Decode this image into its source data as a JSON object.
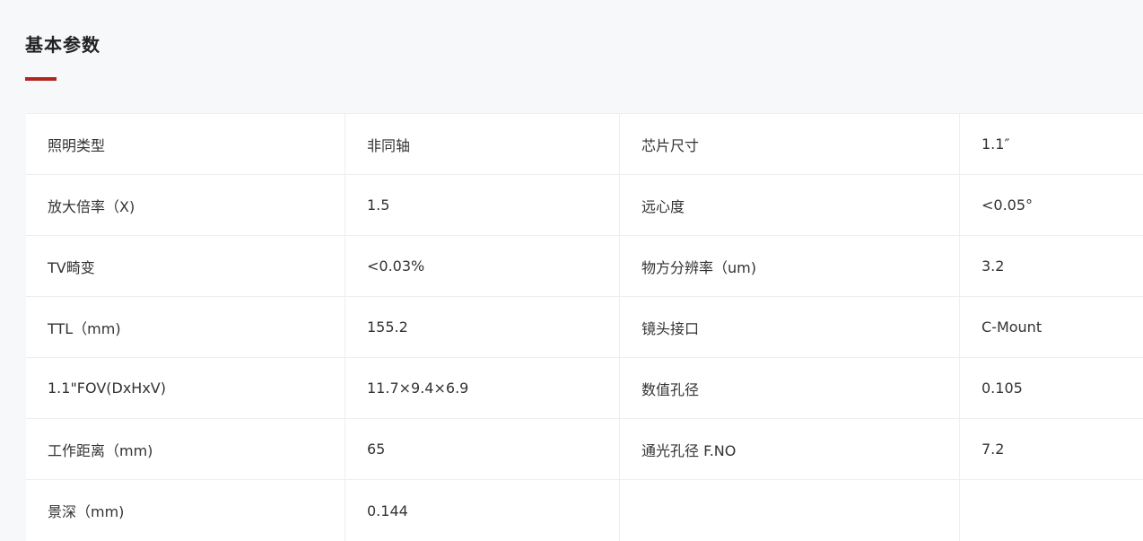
{
  "section": {
    "title": "基本参数",
    "accent_color": "#b1271f"
  },
  "rows": [
    {
      "label1": "照明类型",
      "value1": "非同轴",
      "label2": "芯片尺寸",
      "value2": "1.1″"
    },
    {
      "label1": "放大倍率（X)",
      "value1": "1.5",
      "label2": "远心度",
      "value2": "<0.05°"
    },
    {
      "label1": "TV畸变",
      "value1": "<0.03%",
      "label2": "物方分辨率（um)",
      "value2": "3.2"
    },
    {
      "label1": "TTL（mm)",
      "value1": "155.2",
      "label2": "镜头接口",
      "value2": "C-Mount"
    },
    {
      "label1": "1.1\"FOV(DxHxV)",
      "value1": "11.7×9.4×6.9",
      "label2": "数值孔径",
      "value2": "0.105"
    },
    {
      "label1": "工作距离（mm)",
      "value1": "65",
      "label2": "通光孔径 F.NO",
      "value2": "7.2"
    },
    {
      "label1": "景深（mm)",
      "value1": "0.144",
      "label2": "",
      "value2": ""
    }
  ]
}
